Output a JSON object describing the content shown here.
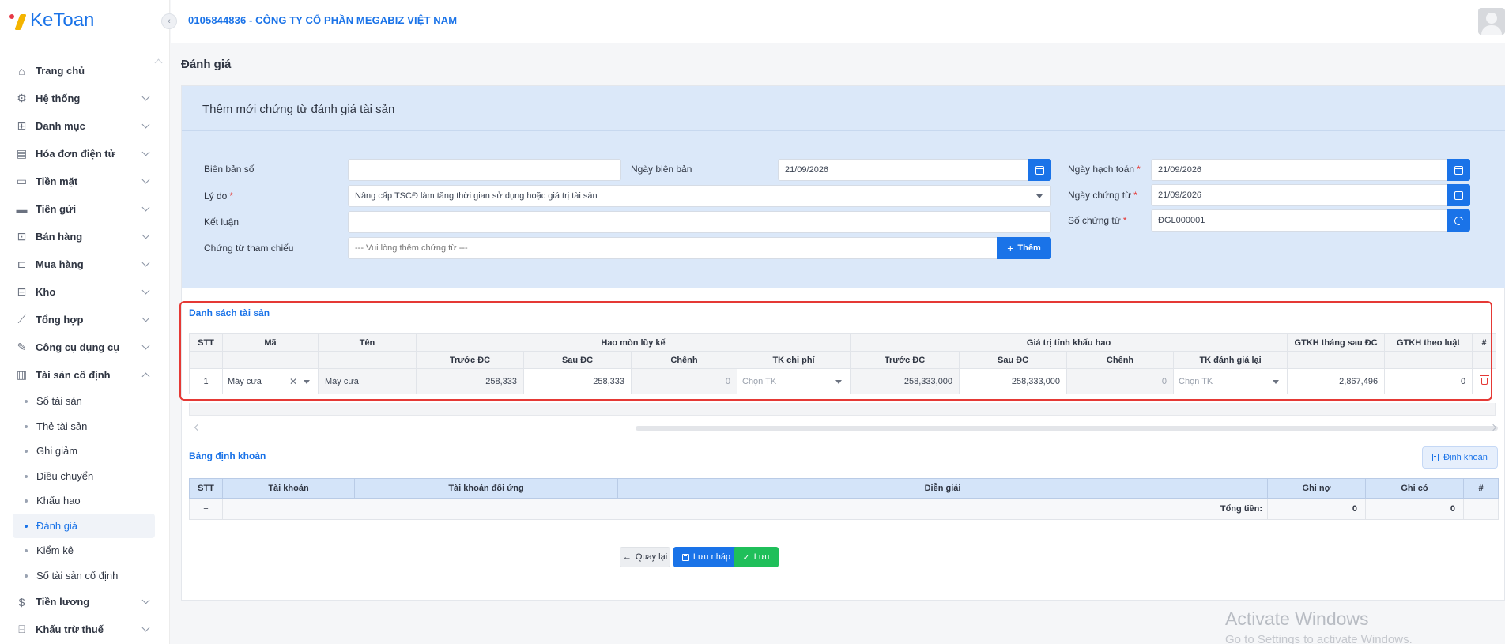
{
  "app": {
    "logo": "KeToan",
    "company": "0105844836 - CÔNG TY CỔ PHẦN MEGABIZ VIỆT NAM"
  },
  "sidebar": {
    "items": [
      {
        "label": "Trang chủ",
        "icon": "home-icon"
      },
      {
        "label": "Hệ thống",
        "icon": "gear-icon"
      },
      {
        "label": "Danh mục",
        "icon": "grid-icon"
      },
      {
        "label": "Hóa đơn điện tử",
        "icon": "invoice-icon"
      },
      {
        "label": "Tiền mặt",
        "icon": "cash-icon"
      },
      {
        "label": "Tiền gửi",
        "icon": "card-icon"
      },
      {
        "label": "Bán hàng",
        "icon": "bag-icon"
      },
      {
        "label": "Mua hàng",
        "icon": "cart-icon"
      },
      {
        "label": "Kho",
        "icon": "warehouse-icon"
      },
      {
        "label": "Tổng hợp",
        "icon": "chart-icon"
      },
      {
        "label": "Công cụ dụng cụ",
        "icon": "tools-icon"
      },
      {
        "label": "Tài sản cố định",
        "icon": "building-icon"
      }
    ],
    "sub_items": [
      "Sổ tài sản",
      "Thẻ tài sản",
      "Ghi giảm",
      "Điều chuyển",
      "Khấu hao",
      "Đánh giá",
      "Kiểm kê",
      "Sổ tài sản cố định"
    ],
    "after_items": [
      {
        "label": "Tiền lương",
        "icon": "salary-icon"
      },
      {
        "label": "Khấu trừ thuế",
        "icon": "tax-icon"
      }
    ]
  },
  "page": {
    "title": "Đánh giá"
  },
  "form": {
    "title": "Thêm mới chứng từ đánh giá tài sản",
    "bien_ban_so_label": "Biên bản số",
    "bien_ban_so_value": "",
    "ngay_bien_ban_label": "Ngày biên bản",
    "ngay_bien_ban_value": "21/09/2026",
    "ly_do_label": "Lý do",
    "ly_do_value": "Nâng cấp TSCĐ làm tăng thời gian sử dụng hoặc giá trị tài sản",
    "ket_luan_label": "Kết luận",
    "ket_luan_value": "",
    "chung_tu_tham_chieu_label": "Chứng từ tham chiếu",
    "chung_tu_tham_chieu_placeholder": "--- Vui lòng thêm chứng từ ---",
    "them_label": "Thêm",
    "ngay_hach_toan_label": "Ngày hạch toán",
    "ngay_hach_toan_value": "21/09/2026",
    "ngay_chung_tu_label": "Ngày chứng từ",
    "ngay_chung_tu_value": "21/09/2026",
    "so_chung_tu_label": "Số chứng từ",
    "so_chung_tu_value": "ĐGL000001",
    "required_mark": "*"
  },
  "asset_list": {
    "title": "Danh sách tài sản",
    "headers": {
      "stt": "STT",
      "ma": "Mã",
      "ten": "Tên",
      "hao_mon": "Hao mòn lũy kế",
      "gia_tri": "Giá trị tính khấu hao",
      "gtkh_sau": "GTKH tháng sau ĐC",
      "gtkh_luat": "GTKH theo luật",
      "hash": "#",
      "truoc_dc": "Trước ĐC",
      "sau_dc": "Sau ĐC",
      "chenh": "Chênh",
      "tk_chi_phi": "TK chi phí",
      "tk_danh_gia_lai": "TK đánh giá lại"
    },
    "rows": [
      {
        "stt": "1",
        "ma": "Máy cưa",
        "ten": "Máy cưa",
        "hm_truoc": "258,333",
        "hm_sau": "258,333",
        "hm_chenh": "0",
        "tk_chi_phi": "Chọn TK",
        "gt_truoc": "258,333,000",
        "gt_sau": "258,333,000",
        "gt_chenh": "0",
        "tk_danh_gia_lai": "Chọn TK",
        "gtkh_sau": "2,867,496",
        "gtkh_luat": "0"
      }
    ]
  },
  "dinh_khoan": {
    "title": "Bảng định khoản",
    "button": "Định khoản",
    "headers": {
      "stt": "STT",
      "tai_khoan": "Tài khoản",
      "tk_doi_ung": "Tài khoản đối ứng",
      "dien_giai": "Diễn giải",
      "ghi_no": "Ghi nợ",
      "ghi_co": "Ghi có",
      "hash": "#"
    },
    "add": "+",
    "tong_tien_label": "Tổng tiền:",
    "tong_no": "0",
    "tong_co": "0"
  },
  "actions": {
    "back": "Quay lại",
    "draft": "Lưu nháp",
    "save": "Lưu"
  },
  "watermark": {
    "line1": "Activate Windows",
    "line2": "Go to Settings to activate Windows."
  },
  "colors": {
    "accent": "#1a73e8",
    "success": "#1fbf5a",
    "danger": "#e53935",
    "panel": "#dbe8f9"
  }
}
